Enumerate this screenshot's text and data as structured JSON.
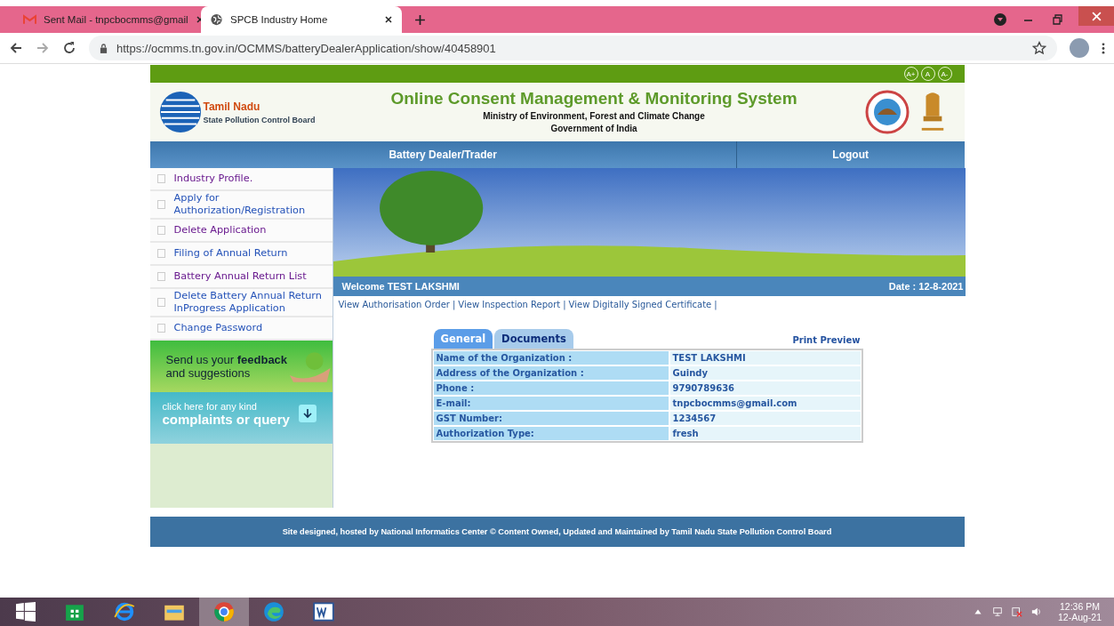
{
  "browser": {
    "tabs": [
      {
        "kind": "mail",
        "title": "Sent Mail - tnpcbocmms@gmail",
        "selected": false
      },
      {
        "kind": "globe",
        "title": "SPCB Industry Home",
        "selected": true
      }
    ],
    "url": "https://ocmms.tn.gov.in/OCMMS/batteryDealerApplication/show/40458901"
  },
  "font_buttons": [
    "A+",
    "A",
    "A-"
  ],
  "header": {
    "org_name": "Tamil Nadu",
    "org_sub": "State Pollution Control Board",
    "title": "Online Consent Management & Monitoring System",
    "ministry": "Ministry of Environment, Forest and Climate Change",
    "government": "Government of India"
  },
  "nav": [
    "Battery Dealer/Trader",
    "Logout"
  ],
  "sidebar": {
    "items": [
      {
        "label": "Industry Profile.",
        "visited": true
      },
      {
        "label": "Apply for Authorization/Registration",
        "visited": false
      },
      {
        "label": "Delete Application",
        "visited": true
      },
      {
        "label": "Filing of Annual Return",
        "visited": false
      },
      {
        "label": "Battery Annual Return List",
        "visited": true
      },
      {
        "label": "Delete Battery Annual Return InProgress Application",
        "visited": false
      },
      {
        "label": "Change Password",
        "visited": false
      }
    ],
    "feedback": "Send us your **feedback** and suggestions",
    "complaint_small": "click here for any kind",
    "complaint_big": "complaints or query"
  },
  "welcome": "Welcome TEST LAKSHMI",
  "date": "Date : 12-8-2021",
  "links": [
    {
      "label": "View Authorisation Order",
      "separator": "|"
    },
    {
      "label": "View Inspection Report",
      "separator": "|"
    },
    {
      "label": "View Digitally Signed Certificate",
      "separator": "|"
    }
  ],
  "tabs": [
    {
      "label": "General",
      "selected": true
    },
    {
      "label": "Documents",
      "selected": false
    }
  ],
  "print_preview": "Print Preview",
  "details": [
    {
      "label": "Name of the Organization :",
      "value": "TEST LAKSHMI"
    },
    {
      "label": "Address of the Organization :",
      "value": "Guindy"
    },
    {
      "label": "Phone :",
      "value": "9790789636"
    },
    {
      "label": "E-mail:",
      "value": "tnpcbocmms@gmail.com"
    },
    {
      "label": "GST Number:",
      "value": "1234567"
    },
    {
      "label": "Authorization Type:",
      "value": "fresh"
    }
  ],
  "footer": "Site designed, hosted by National Informatics Center © Content Owned, Updated and Maintained by Tamil Nadu State Pollution Control Board",
  "taskbar": {
    "apps": [
      {
        "kind": "store",
        "selected": false
      },
      {
        "kind": "ie",
        "selected": false
      },
      {
        "kind": "files",
        "selected": false
      },
      {
        "kind": "chrome",
        "selected": true
      },
      {
        "kind": "edge",
        "selected": false
      },
      {
        "kind": "word",
        "selected": false
      }
    ],
    "time": "12:36 PM",
    "date": "12-Aug-21"
  }
}
